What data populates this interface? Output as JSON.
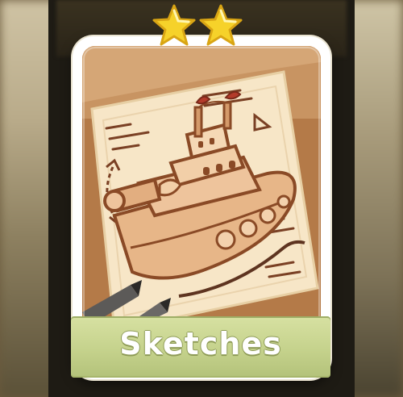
{
  "card": {
    "title": "Sketches",
    "star_count": 2,
    "colors": {
      "star": "#f6d22a",
      "banner": "#c5d28c",
      "frame": "#ffffff",
      "paper": "#f4e2c2",
      "ink": "#8a4a26"
    }
  },
  "icons": [
    "star-icon",
    "star-icon"
  ]
}
